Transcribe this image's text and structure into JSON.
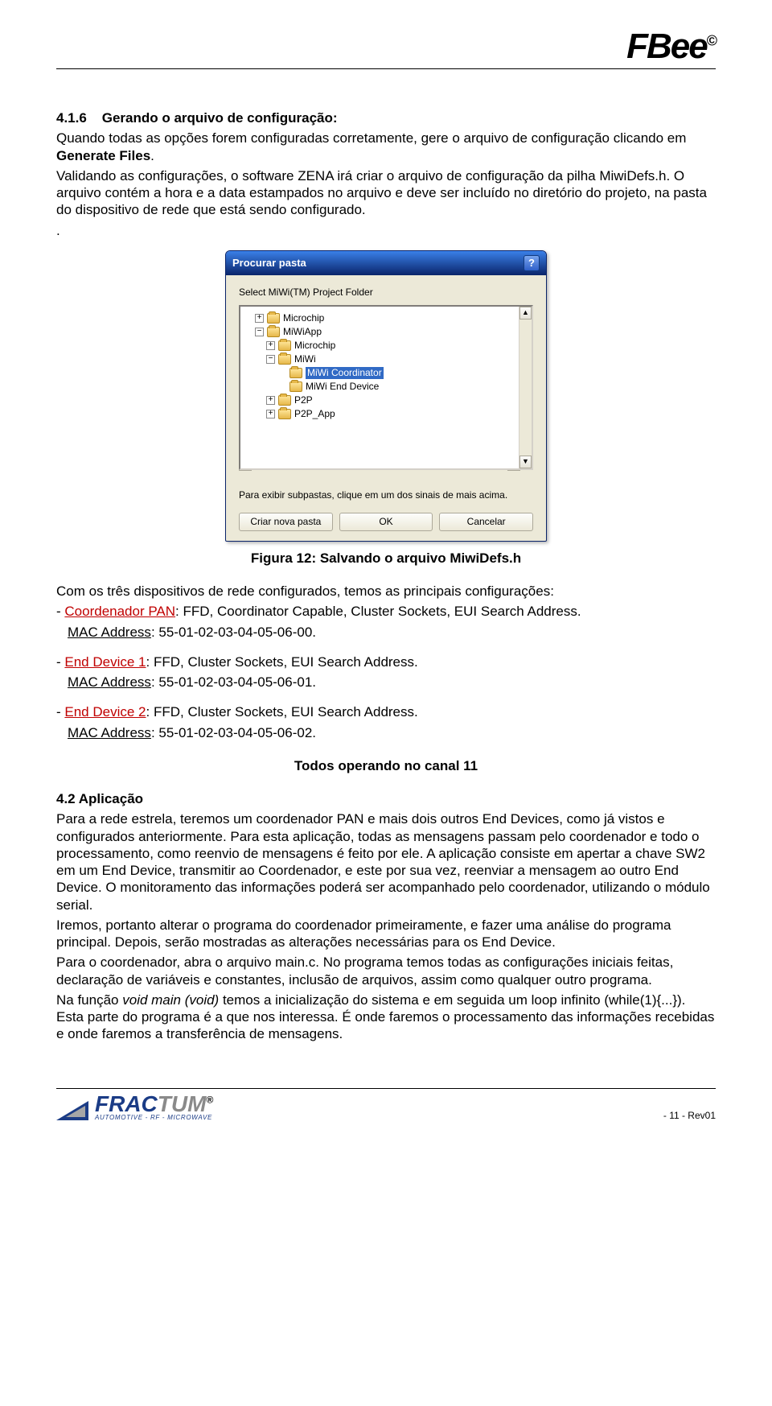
{
  "header": {
    "brand": "FBee",
    "brand_sup": "©"
  },
  "section416": {
    "number": "4.1.6",
    "title": "Gerando o arquivo de configuração:",
    "p1a": "Quando todas as opções forem configuradas corretamente, gere o arquivo de configuração clicando em ",
    "p1_bold": "Generate Files",
    "p1b": ".",
    "p2": "Validando as configurações, o software ZENA irá criar o arquivo de configuração da pilha MiwiDefs.h. O arquivo contém a hora e a data estampados no arquivo e deve ser incluído no diretório do projeto, na pasta do dispositivo de rede que está sendo configurado.",
    "p2_trailing": "."
  },
  "dialog": {
    "title": "Procurar pasta",
    "help": "?",
    "label": "Select MiWi(TM) Project Folder",
    "tree": {
      "n0": {
        "tw": "+",
        "label": "Microchip"
      },
      "n1": {
        "tw": "−",
        "label": "MiWiApp"
      },
      "n2": {
        "tw": "+",
        "label": "Microchip"
      },
      "n3": {
        "tw": "−",
        "label": "MiWi"
      },
      "n4": {
        "label": "MiWi Coordinator"
      },
      "n5": {
        "label": "MiWi End Device"
      },
      "n6": {
        "tw": "+",
        "label": "P2P"
      },
      "n7": {
        "tw": "+",
        "label": "P2P_App"
      }
    },
    "scroll": {
      "up": "▲",
      "down": "▼",
      "left": "◄",
      "right": "►"
    },
    "hint": "Para exibir subpastas, clique em um dos sinais de mais acima.",
    "buttons": {
      "new": "Criar nova pasta",
      "ok": "OK",
      "cancel": "Cancelar"
    }
  },
  "figcaption": "Figura 12: Salvando o arquivo MiwiDefs.h",
  "config": {
    "intro": "Com os três dispositivos de rede configurados, temos as principais configurações:",
    "dash": "- ",
    "coord_label": "Coordenador PAN",
    "coord_rest": ": FFD, Coordinator Capable, Cluster Sockets, EUI Search Address.",
    "mac_label": "MAC Address",
    "coord_mac": ": 55-01-02-03-04-05-06-00.",
    "ed1_label": "End Device 1",
    "ed1_rest": ": FFD, Cluster Sockets, EUI Search Address.",
    "ed1_mac": ": 55-01-02-03-04-05-06-01.",
    "ed2_label": "End Device 2",
    "ed2_rest": ": FFD, Cluster Sockets, EUI Search Address.",
    "ed2_mac": ": 55-01-02-03-04-05-06-02.",
    "channel": "Todos operando no canal 11"
  },
  "section42": {
    "heading": "4.2  Aplicação",
    "p1": "Para a rede estrela, teremos um coordenador PAN e mais dois outros End Devices, como já vistos e configurados anteriormente. Para esta aplicação, todas as mensagens passam pelo coordenador e todo o processamento, como reenvio de mensagens é feito por ele. A aplicação consiste em apertar a chave SW2 em um End Device, transmitir ao Coordenador, e este por sua vez, reenviar a mensagem ao outro End Device. O monitoramento das informações poderá ser acompanhado pelo coordenador, utilizando o módulo serial.",
    "p2": "Iremos, portanto alterar o programa do coordenador primeiramente, e fazer uma análise do programa principal. Depois, serão mostradas as alterações necessárias para os End Device.",
    "p3": "Para o coordenador, abra o arquivo main.c. No programa temos todas as configurações iniciais feitas, declaração de variáveis e constantes, inclusão de arquivos, assim como qualquer outro programa.",
    "p4a": "Na função ",
    "p4_it": "void main (void)",
    "p4b": " temos a inicialização do sistema e em seguida um loop infinito (while(1){...}). Esta parte do programa é a que nos interessa. É onde faremos o processamento das informações recebidas e onde faremos a transferência de mensagens."
  },
  "footer": {
    "brand1": "FRAC",
    "brand2": "TUM",
    "reg": "®",
    "tag": "AUTOMOTIVE - RF - MICROWAVE",
    "page": "- 11 -  Rev01"
  }
}
